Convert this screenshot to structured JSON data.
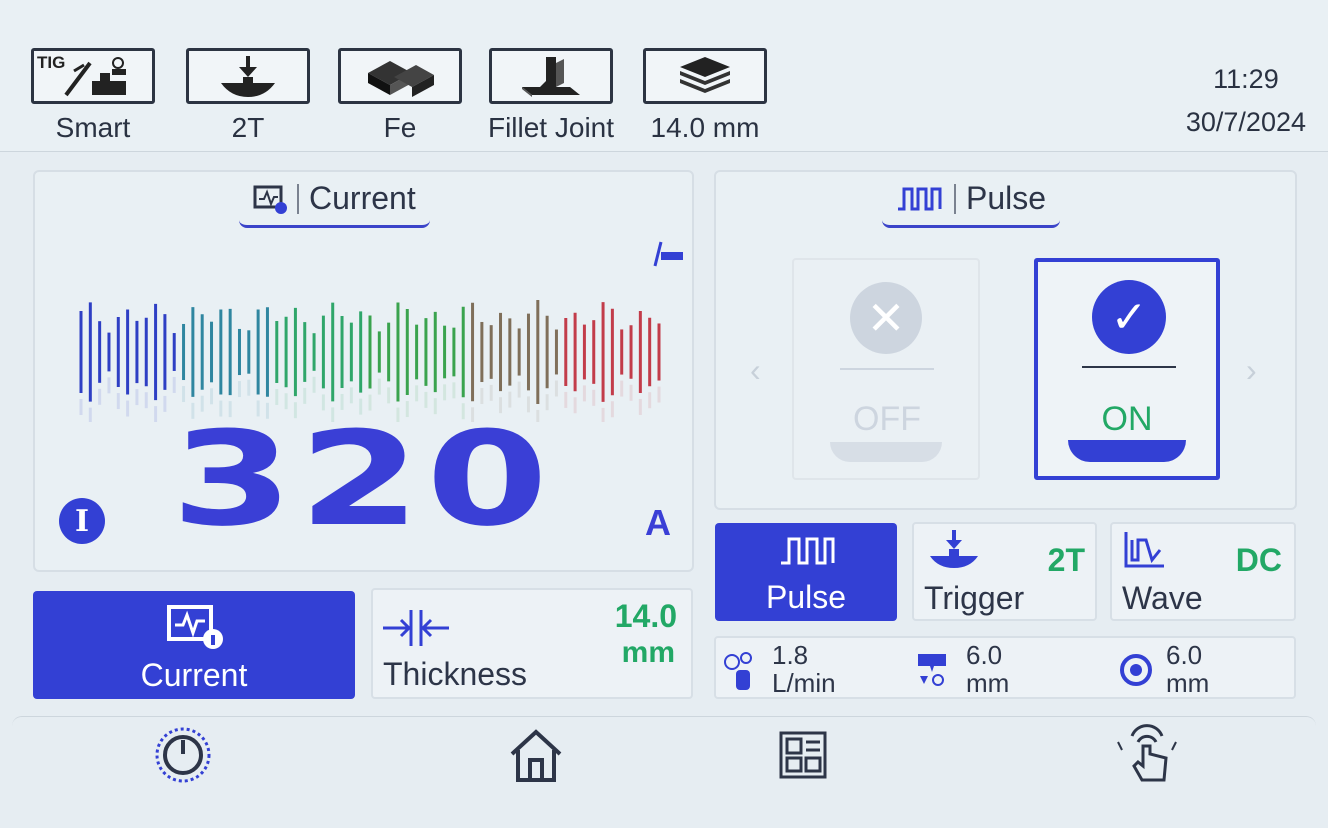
{
  "header": {
    "buttons": [
      {
        "label": "Smart",
        "icon": "tig-torch-icon",
        "badge": "TIG"
      },
      {
        "label": "2T",
        "icon": "trigger-2t-icon"
      },
      {
        "label": "Fe",
        "icon": "iron-material-icon"
      },
      {
        "label": "Fillet Joint",
        "icon": "fillet-joint-icon"
      },
      {
        "label": "14.0 mm",
        "icon": "plate-thickness-icon"
      }
    ],
    "time": "11:29",
    "date": "30/7/2024"
  },
  "current_panel": {
    "title": "Current",
    "value": "320",
    "unit": "A",
    "indicator": "I"
  },
  "pulse_panel": {
    "title": "Pulse",
    "off_label": "OFF",
    "on_label": "ON",
    "selected": "ON"
  },
  "params": {
    "current_label": "Current",
    "thickness_label": "Thickness",
    "thickness_value": "14.0",
    "thickness_unit": "mm",
    "pulse_label": "Pulse",
    "trigger_label": "Trigger",
    "trigger_value": "2T",
    "wave_label": "Wave",
    "wave_value": "DC"
  },
  "gas": {
    "flow_value": "1.8",
    "flow_unit": "L/min",
    "tungsten_value": "6.0",
    "tungsten_unit": "mm",
    "nozzle_value": "6.0",
    "nozzle_unit": "mm"
  },
  "colors": {
    "accent": "#3340d4",
    "value_green": "#22a866",
    "bars": [
      "#2e3fc4",
      "#2f86a0",
      "#2fa66a",
      "#3aa34e",
      "#7f6f5a",
      "#c23c4a"
    ]
  },
  "bottom_nav": [
    "power-icon",
    "home-icon",
    "menu-grid-icon",
    "touch-icon"
  ]
}
